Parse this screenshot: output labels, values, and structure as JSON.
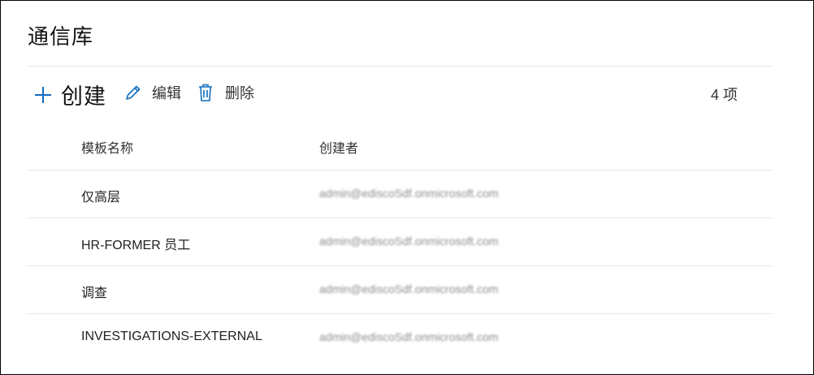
{
  "page": {
    "title": "通信库"
  },
  "toolbar": {
    "create_label": "创建",
    "edit_label": "编辑",
    "delete_label": "删除",
    "count": "4 项"
  },
  "table": {
    "columns": [
      "模板名称",
      "创建者"
    ],
    "rows": [
      {
        "name": "仅高层",
        "owner": "admin@ediscoSdf.onmicrosoft.com"
      },
      {
        "name": "HR-FORMER 员工",
        "owner": "admin@ediscoSdf.onmicrosoft.com"
      },
      {
        "name": "调查",
        "owner": "admin@ediscoSdf.onmicrosoft.com"
      },
      {
        "name": "INVESTIGATIONS-EXTERNAL",
        "owner": "admin@ediscoSdf.onmicrosoft.com"
      }
    ]
  },
  "colors": {
    "accent": "#0f6cbd",
    "divider": "#e6e6e6"
  },
  "icons": {
    "create": "plus-icon",
    "edit": "pencil-icon",
    "delete": "trash-icon"
  }
}
